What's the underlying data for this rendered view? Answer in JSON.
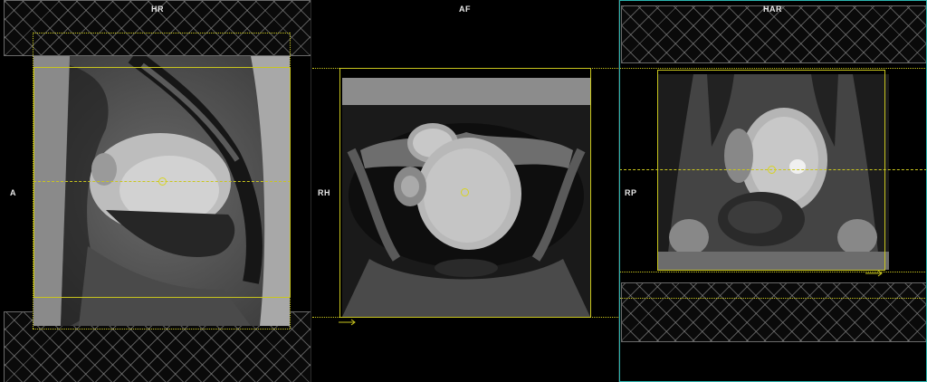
{
  "viewports": {
    "sagittal": {
      "top_label": "HR",
      "left_label": "A"
    },
    "axial": {
      "top_label": "AF",
      "left_label": "RH"
    },
    "coronal": {
      "top_label": "HAR",
      "left_label": "RP"
    }
  },
  "colors": {
    "planning_line": "#c9c61e",
    "active_viewport_frame": "#2bb5b0",
    "saturation_band_hatch": "#969696"
  },
  "icons": {
    "center_marker": "yellow-circle-icon",
    "direction_marker": "arrow-right-icon"
  }
}
